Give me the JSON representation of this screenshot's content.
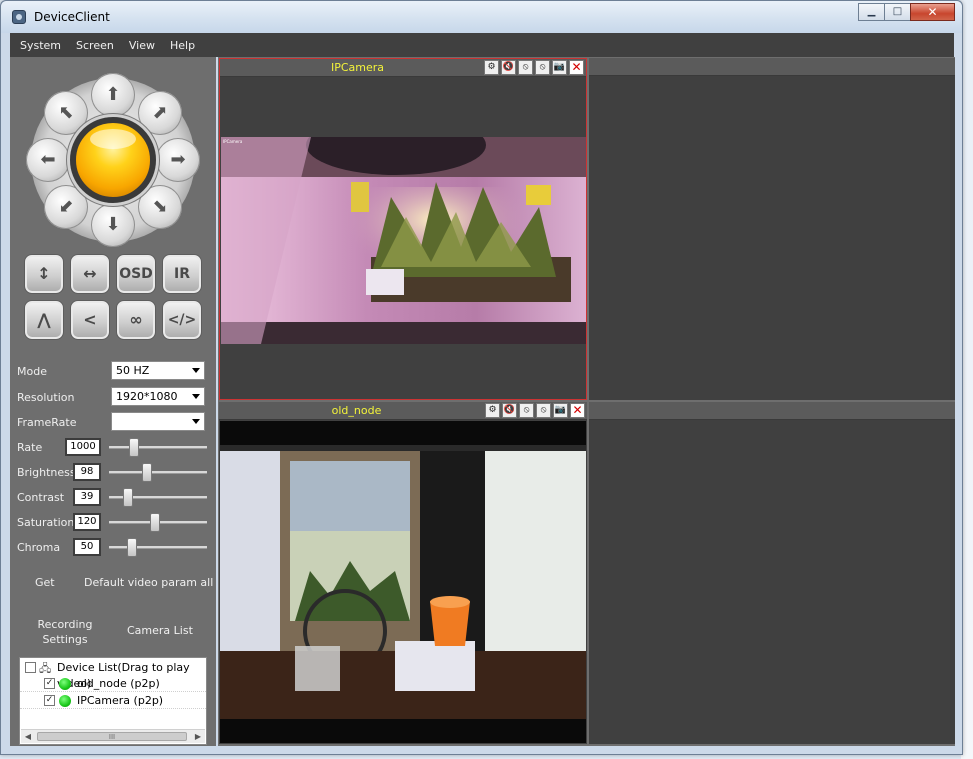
{
  "window": {
    "title": "DeviceClient"
  },
  "window_controls": {
    "minimize": "▁",
    "maximize": "□",
    "close": "✕"
  },
  "menu": [
    "System",
    "Screen",
    "View",
    "Help"
  ],
  "ptz": {
    "directions": [
      "up",
      "up-right",
      "right",
      "down-right",
      "down",
      "down-left",
      "left",
      "up-left"
    ],
    "arrows": [
      "⬆",
      "⬈",
      "➡",
      "⬊",
      "⬇",
      "⬋",
      "⬅",
      "⬉"
    ]
  },
  "tools": {
    "row1": [
      {
        "name": "flip-vertical",
        "label": "↕"
      },
      {
        "name": "flip-horizontal",
        "label": "↔"
      },
      {
        "name": "osd",
        "label": "OSD"
      },
      {
        "name": "ir",
        "label": "IR"
      }
    ],
    "row2": [
      {
        "name": "cruise-vertical",
        "label": "⋀"
      },
      {
        "name": "cruise-horizontal",
        "label": "<"
      },
      {
        "name": "cruise-loop",
        "label": "∞"
      },
      {
        "name": "stop-cruise",
        "label": "</>"
      }
    ]
  },
  "params": {
    "mode": {
      "label": "Mode",
      "value": "50 HZ"
    },
    "resolution": {
      "label": "Resolution",
      "value": "1920*1080"
    },
    "framerate": {
      "label": "FrameRate",
      "value": ""
    },
    "rate": {
      "label": "Rate",
      "value": "1000",
      "level": 0.25
    },
    "brightness": {
      "label": "Brightness",
      "value": "98",
      "level": 0.39
    },
    "contrast": {
      "label": "Contrast",
      "value": "39",
      "level": 0.19
    },
    "saturation": {
      "label": "Saturation",
      "value": "120",
      "level": 0.47
    },
    "chroma": {
      "label": "Chroma",
      "value": "50",
      "level": 0.23
    }
  },
  "actions": {
    "get": "Get",
    "default_params": "Default video param all",
    "recording_settings_1": "Recording",
    "recording_settings_2": "Settings",
    "camera_list": "Camera List"
  },
  "device_list": {
    "header": "Device List(Drag to play video)",
    "devices": [
      {
        "name": "old_node (p2p)",
        "checked": "✓",
        "status_color": "#19c819"
      },
      {
        "name": "IPCamera (p2p)",
        "checked": "✓",
        "status_color": "#19c819"
      }
    ],
    "scroll_thumb": "III"
  },
  "panes": [
    {
      "title": "IPCamera",
      "tools": [
        "⚙",
        "🔇",
        "⦸",
        "⦸",
        "📷",
        "✕"
      ]
    },
    {
      "title": "old_node",
      "tools": [
        "⚙",
        "🔇",
        "⦸",
        "⦸",
        "📷",
        "✕"
      ]
    }
  ],
  "video1": {
    "overlay": "IPCamera"
  },
  "colors": {
    "pane_title": "#f3f33a",
    "active_border": "#c33",
    "panel_bg": "#6e6e6e"
  }
}
